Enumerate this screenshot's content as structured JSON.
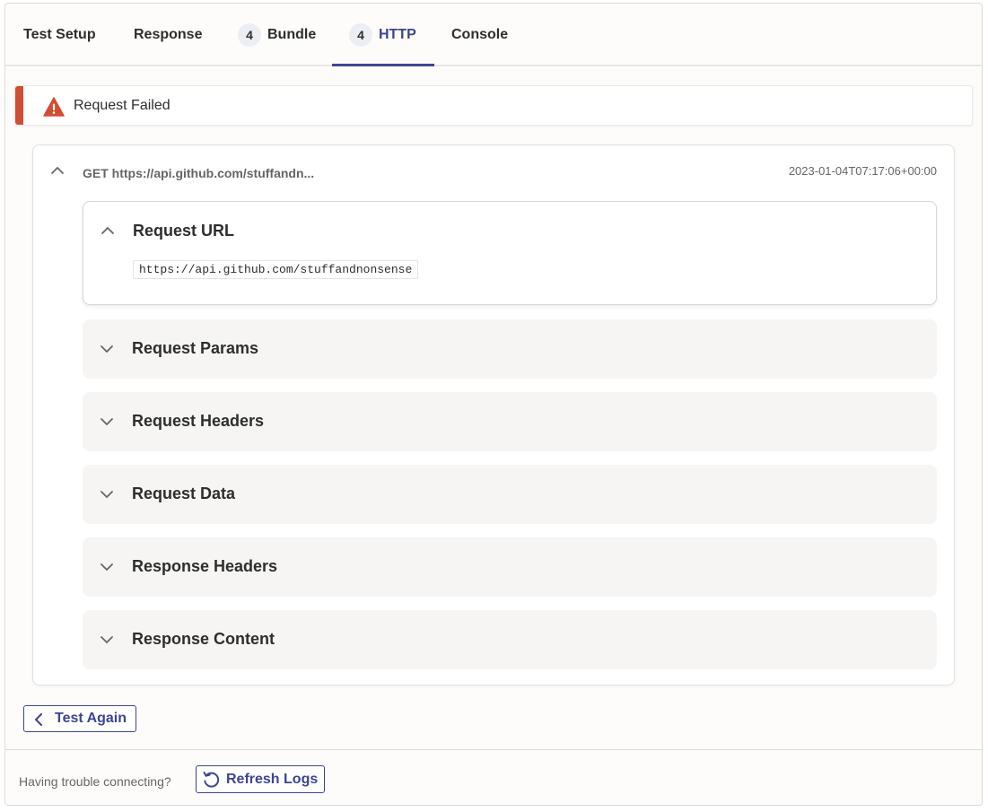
{
  "tabs": [
    {
      "label": "Test Setup",
      "badge": null,
      "active": false
    },
    {
      "label": "Response",
      "badge": null,
      "active": false
    },
    {
      "label": "Bundle",
      "badge": "4",
      "active": false
    },
    {
      "label": "HTTP",
      "badge": "4",
      "active": true
    },
    {
      "label": "Console",
      "badge": null,
      "active": false
    }
  ],
  "alert": {
    "text": "Request Failed",
    "icon": "warning-triangle-icon",
    "color": "#d14e32"
  },
  "log": {
    "method_url": "GET https://api.github.com/stuffandn...",
    "timestamp": "2023-01-04T07:17:06+00:00",
    "expanded": true,
    "sections": [
      {
        "title": "Request URL",
        "expanded": true,
        "content": "https://api.github.com/stuffandnonsense"
      },
      {
        "title": "Request Params",
        "expanded": false
      },
      {
        "title": "Request Headers",
        "expanded": false
      },
      {
        "title": "Request Data",
        "expanded": false
      },
      {
        "title": "Response Headers",
        "expanded": false
      },
      {
        "title": "Response Content",
        "expanded": false
      }
    ]
  },
  "actions": {
    "test_again_label": "Test Again"
  },
  "footer": {
    "trouble_text": "Having trouble connecting?",
    "refresh_label": "Refresh Logs"
  },
  "colors": {
    "accent": "#3d4592",
    "error": "#d14e32"
  }
}
